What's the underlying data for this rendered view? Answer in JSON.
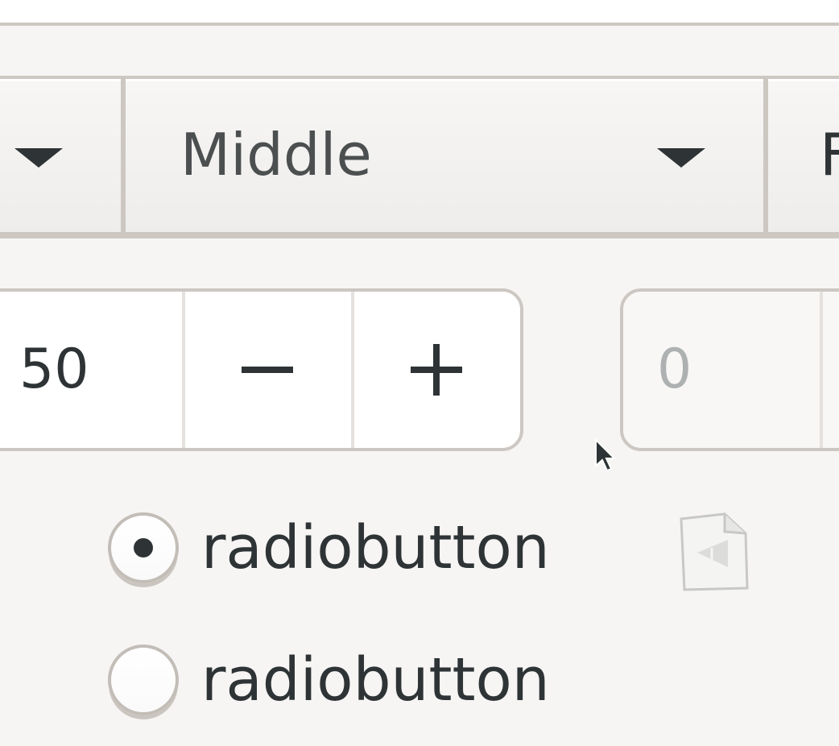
{
  "toolbar": {
    "combo_left": {
      "label": "",
      "icon": "chevron-down-icon"
    },
    "combo_middle": {
      "label": "Middle",
      "icon": "chevron-down-icon"
    },
    "combo_right": {
      "label": "F"
    }
  },
  "spinners": {
    "left": {
      "value": "50",
      "minus_label": "−",
      "plus_label": "+"
    },
    "right": {
      "value": "0"
    }
  },
  "radios": [
    {
      "label": "radiobutton",
      "checked": true
    },
    {
      "label": "radiobutton",
      "checked": false
    }
  ],
  "icons": {
    "file_icon": "image-missing-icon",
    "pointer": "mouse-pointer-icon"
  },
  "colors": {
    "background": "#f6f5f4",
    "border": "#cdc7c2",
    "text": "#2e3436",
    "disabled_text": "#aeb1b1"
  }
}
